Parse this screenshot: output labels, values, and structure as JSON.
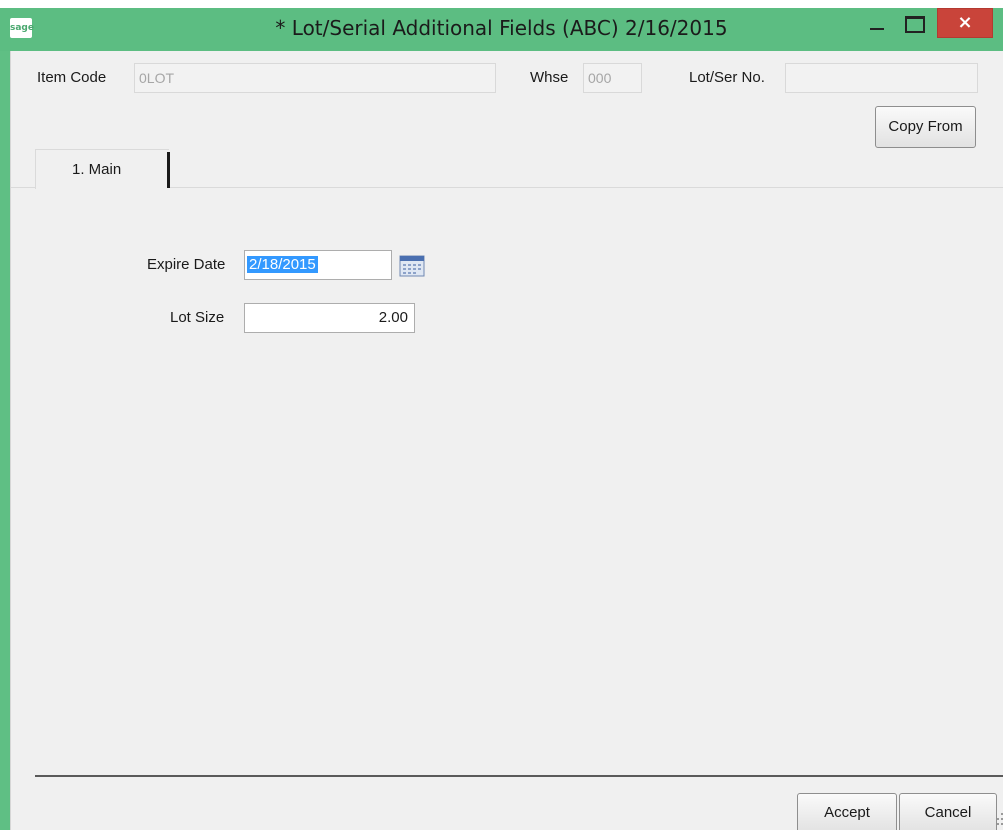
{
  "window": {
    "title": "* Lot/Serial Additional Fields (ABC) 2/16/2015",
    "app_logo_text": "sage",
    "close_glyph": "×",
    "titlebar_color": "#5cbd82",
    "close_color": "#c9443a"
  },
  "header": {
    "item_code_label": "Item Code",
    "item_code_value": "0LOT",
    "whse_label": "Whse",
    "whse_value": "000",
    "lot_ser_label": "Lot/Ser No.",
    "lot_ser_value": ""
  },
  "toolbar": {
    "copy_from_label": "Copy From"
  },
  "tabs": [
    {
      "label": "1. Main",
      "selected": true
    }
  ],
  "main": {
    "expire_date_label": "Expire Date",
    "expire_date_value": "2/18/2015",
    "lot_size_label": "Lot Size",
    "lot_size_value": "2.00"
  },
  "footer": {
    "accept_label": "Accept",
    "cancel_label": "Cancel"
  },
  "icons": {
    "calendar": "calendar-icon",
    "minimize": "minimize-icon",
    "maximize": "maximize-icon",
    "close": "close-icon"
  },
  "colors": {
    "selection": "#3399ff",
    "dialog_bg": "#f0f0f0"
  }
}
